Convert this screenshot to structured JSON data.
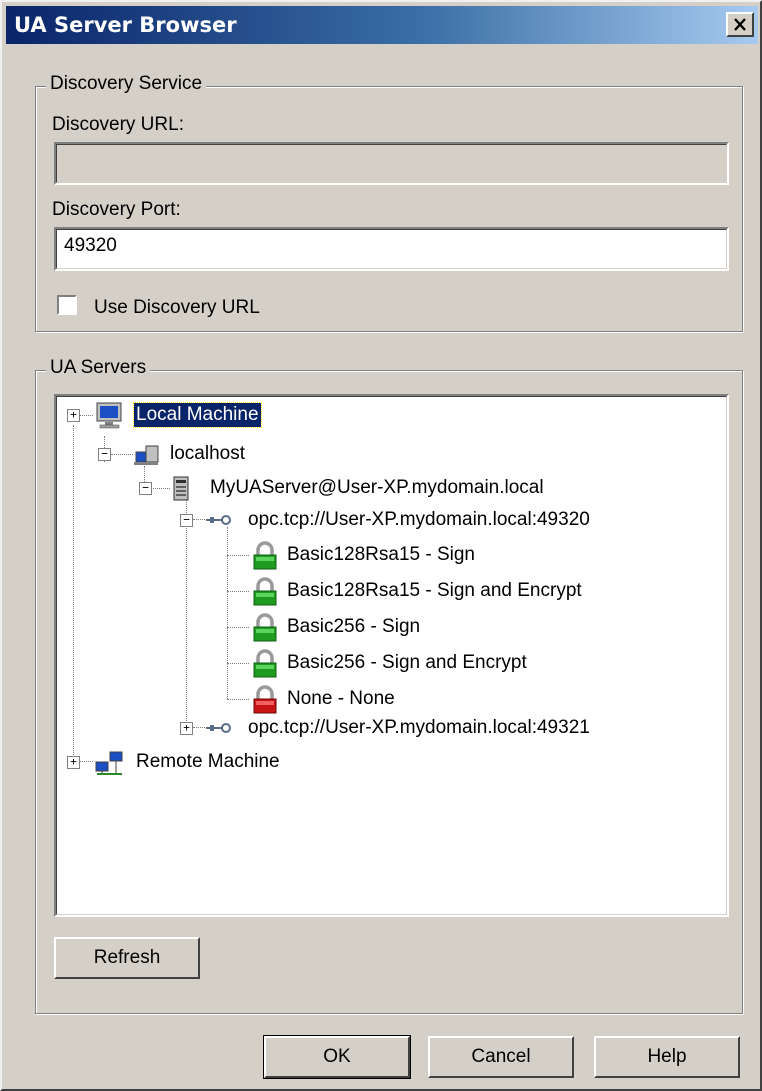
{
  "window": {
    "title": "UA Server Browser",
    "close_glyph": "X"
  },
  "discovery": {
    "legend": "Discovery Service",
    "url_label": "Discovery URL:",
    "url_value": "",
    "port_label": "Discovery Port:",
    "port_value": "49320",
    "use_url_label": "Use Discovery URL",
    "use_url_checked": false
  },
  "servers": {
    "legend": "UA Servers",
    "tree": {
      "local_machine": "Local Machine",
      "localhost": "localhost",
      "server": "MyUAServer@User-XP.mydomain.local",
      "endpoint_1": "opc.tcp://User-XP.mydomain.local:49320",
      "policies": [
        {
          "label": "Basic128Rsa15 - Sign",
          "lock": "green"
        },
        {
          "label": "Basic128Rsa15 - Sign and Encrypt",
          "lock": "green"
        },
        {
          "label": "Basic256 - Sign",
          "lock": "green"
        },
        {
          "label": "Basic256 - Sign and Encrypt",
          "lock": "green"
        },
        {
          "label": "None - None",
          "lock": "red"
        }
      ],
      "endpoint_2": "opc.tcp://User-XP.mydomain.local:49321",
      "remote_machine": "Remote Machine"
    },
    "refresh_label": "Refresh"
  },
  "buttons": {
    "ok": "OK",
    "cancel": "Cancel",
    "help": "Help"
  },
  "colors": {
    "titlebar_start": "#0a246a",
    "titlebar_end": "#a6caf0",
    "dialog_bg": "#d4d0c8",
    "lock_green": "#1f9b1f",
    "lock_red": "#c81414"
  }
}
